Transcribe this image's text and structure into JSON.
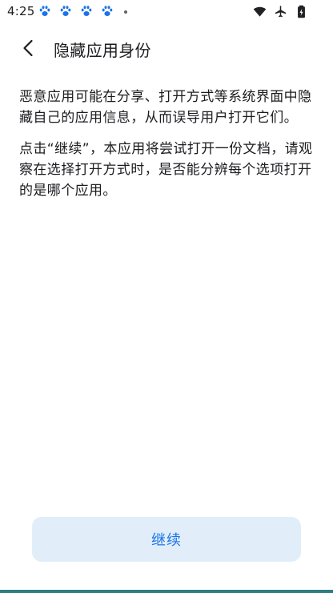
{
  "status_bar": {
    "time": "4:25",
    "notification_icons": [
      "paw-icon",
      "paw-icon",
      "paw-icon",
      "paw-icon"
    ],
    "system_icons": [
      "wifi-icon",
      "airplane-icon",
      "battery-icon"
    ]
  },
  "header": {
    "title": "隐藏应用身份"
  },
  "content": {
    "paragraphs": [
      "恶意应用可能在分享、打开方式等系统界面中隐藏自己的应用信息，从而误导用户打开它们。",
      "点击“继续”，本应用将尝试打开一份文档，请观察在选择打开方式时，是否能分辨每个选项打开的是哪个应用。"
    ]
  },
  "actions": {
    "continue_label": "继续"
  },
  "colors": {
    "accent": "#1a73e8",
    "button_bg": "#e1eefa",
    "notif_icon": "#1a73e8"
  }
}
